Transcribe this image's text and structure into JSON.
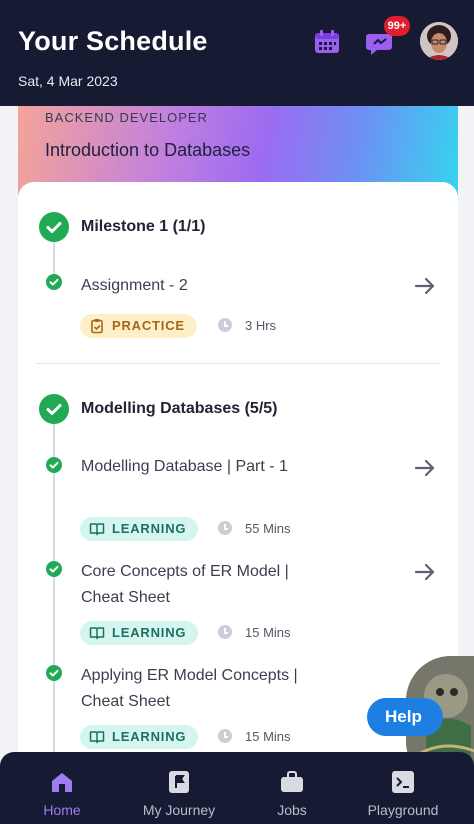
{
  "header": {
    "title": "Your Schedule",
    "date": "Sat, 4 Mar 2023",
    "notification_badge": "99+",
    "icons": [
      "calendar-icon",
      "chat-icon",
      "avatar"
    ]
  },
  "course": {
    "category": "BACKEND DEVELOPER",
    "title": "Introduction to Databases"
  },
  "milestones": [
    {
      "title": "Milestone 1 (1/1)",
      "items": [
        {
          "title": "Assignment - 2",
          "tag": "PRACTICE",
          "duration": "3 Hrs"
        }
      ]
    },
    {
      "title": "Modelling Databases (5/5)",
      "items": [
        {
          "title": "Modelling Database | Part - 1",
          "tag": "LEARNING",
          "duration": "55 Mins"
        },
        {
          "title": "Core Concepts of ER Model | Cheat Sheet",
          "tag": "LEARNING",
          "duration": "15 Mins"
        },
        {
          "title": "Applying ER Model Concepts | Cheat Sheet",
          "tag": "LEARNING",
          "duration": "15 Mins"
        }
      ]
    }
  ],
  "help": {
    "label": "Help"
  },
  "nav": [
    {
      "label": "Home",
      "icon": "home-icon",
      "active": true
    },
    {
      "label": "My Journey",
      "icon": "flag-icon",
      "active": false
    },
    {
      "label": "Jobs",
      "icon": "briefcase-icon",
      "active": false
    },
    {
      "label": "Playground",
      "icon": "terminal-icon",
      "active": false
    }
  ],
  "colors": {
    "header_bg": "#161b33",
    "accent_purple": "#9d7df2",
    "check_green": "#22a954",
    "practice_bg": "#fdf0c9",
    "learning_bg": "#d4f6ef",
    "help_blue": "#1e7fe3"
  }
}
